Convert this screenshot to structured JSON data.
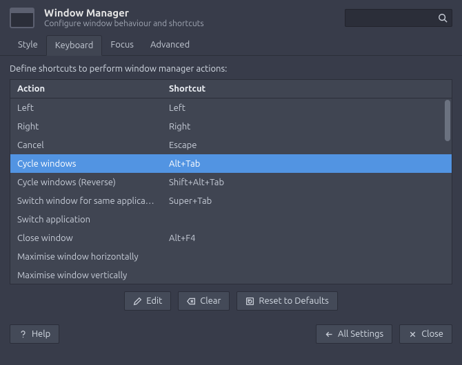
{
  "header": {
    "title": "Window Manager",
    "subtitle": "Configure window behaviour and shortcuts",
    "search_placeholder": ""
  },
  "tabs": {
    "items": [
      {
        "label": "Style"
      },
      {
        "label": "Keyboard"
      },
      {
        "label": "Focus"
      },
      {
        "label": "Advanced"
      }
    ],
    "active_index": 1
  },
  "instruction": "Define shortcuts to perform window manager actions:",
  "columns": {
    "action": "Action",
    "shortcut": "Shortcut"
  },
  "rows": [
    {
      "action": "Left",
      "shortcut": "Left"
    },
    {
      "action": "Right",
      "shortcut": "Right"
    },
    {
      "action": "Cancel",
      "shortcut": "Escape"
    },
    {
      "action": "Cycle windows",
      "shortcut": "Alt+Tab",
      "selected": true
    },
    {
      "action": "Cycle windows (Reverse)",
      "shortcut": "Shift+Alt+Tab"
    },
    {
      "action": "Switch window for same application",
      "shortcut": "Super+Tab"
    },
    {
      "action": "Switch application",
      "shortcut": ""
    },
    {
      "action": "Close window",
      "shortcut": "Alt+F4"
    },
    {
      "action": "Maximise window horizontally",
      "shortcut": ""
    },
    {
      "action": "Maximise window vertically",
      "shortcut": ""
    }
  ],
  "buttons": {
    "edit": "Edit",
    "clear": "Clear",
    "reset": "Reset to Defaults",
    "help": "Help",
    "all_settings": "All Settings",
    "close": "Close"
  }
}
